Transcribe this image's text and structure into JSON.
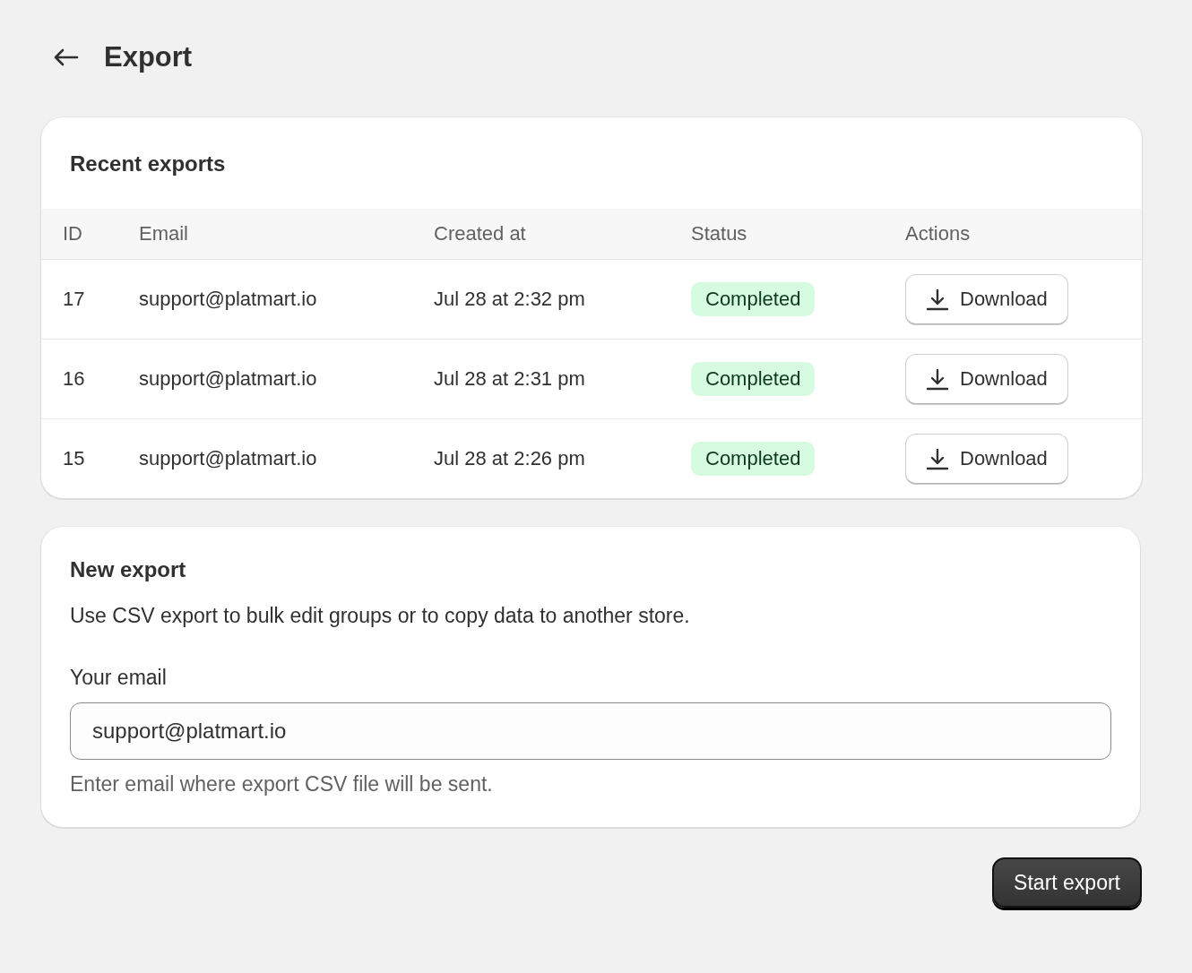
{
  "page": {
    "title": "Export"
  },
  "recent_exports": {
    "title": "Recent exports",
    "columns": [
      "ID",
      "Email",
      "Created at",
      "Status",
      "Actions"
    ],
    "rows": [
      {
        "id": "17",
        "email": "support@platmart.io",
        "created_at": "Jul 28 at 2:32 pm",
        "status": {
          "label": "Completed",
          "kind": "success"
        },
        "action": "Download"
      },
      {
        "id": "16",
        "email": "support@platmart.io",
        "created_at": "Jul 28 at 2:31 pm",
        "status": {
          "label": "Completed",
          "kind": "success"
        },
        "action": "Download"
      },
      {
        "id": "15",
        "email": "support@platmart.io",
        "created_at": "Jul 28 at 2:26 pm",
        "status": {
          "label": "Completed",
          "kind": "success"
        },
        "action": "Download"
      }
    ]
  },
  "new_export": {
    "title": "New export",
    "description": "Use CSV export to bulk edit groups or to copy data to another store.",
    "field_label": "Your email",
    "field_value": "support@platmart.io",
    "help_text": "Enter email where export CSV file will be sent."
  },
  "primary_button": "Start export"
}
